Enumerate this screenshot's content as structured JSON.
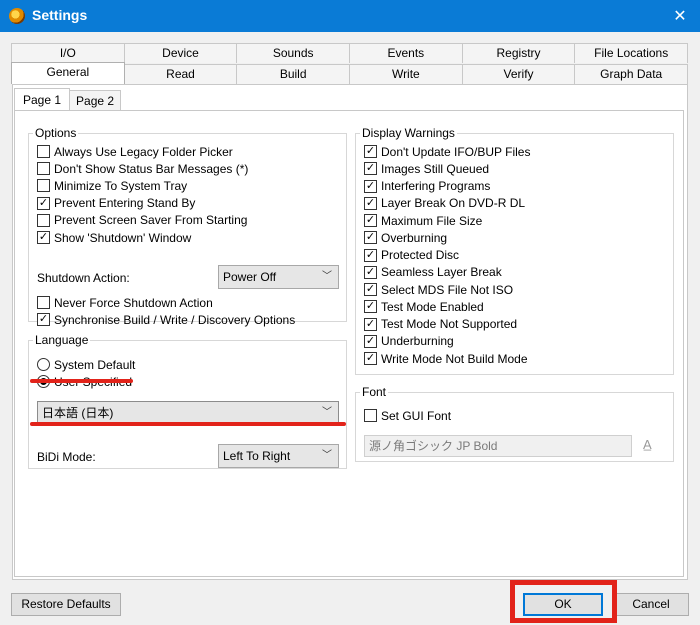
{
  "window": {
    "title": "Settings",
    "close_glyph": "✕"
  },
  "tabs_row1": [
    "I/O",
    "Device",
    "Sounds",
    "Events",
    "Registry",
    "File Locations"
  ],
  "tabs_row2": [
    "General",
    "Read",
    "Build",
    "Write",
    "Verify",
    "Graph Data"
  ],
  "active_tab": "General",
  "subtabs": [
    "Page 1",
    "Page 2"
  ],
  "options": {
    "legend": "Options",
    "items": [
      {
        "label": "Always Use Legacy Folder Picker",
        "checked": false
      },
      {
        "label": "Don't Show Status Bar Messages (*)",
        "checked": false
      },
      {
        "label": "Minimize To System Tray",
        "checked": false
      },
      {
        "label": "Prevent Entering Stand By",
        "checked": true
      },
      {
        "label": "Prevent Screen Saver From Starting",
        "checked": false
      },
      {
        "label": "Show 'Shutdown' Window",
        "checked": true
      }
    ],
    "shutdown_label": "Shutdown Action:",
    "shutdown_value": "Power Off",
    "items2": [
      {
        "label": "Never Force Shutdown Action",
        "checked": false
      },
      {
        "label": "Synchronise Build / Write / Discovery Options",
        "checked": true
      }
    ]
  },
  "language": {
    "legend": "Language",
    "radio_system": "System Default",
    "radio_user": "User Specified",
    "selected": "User Specified",
    "value": "日本語 (日本)",
    "bidi_label": "BiDi Mode:",
    "bidi_value": "Left To Right"
  },
  "warnings": {
    "legend": "Display Warnings",
    "items": [
      {
        "label": "Don't Update IFO/BUP Files",
        "checked": true
      },
      {
        "label": "Images Still Queued",
        "checked": true
      },
      {
        "label": "Interfering Programs",
        "checked": true
      },
      {
        "label": "Layer Break On DVD-R DL",
        "checked": true
      },
      {
        "label": "Maximum File Size",
        "checked": true
      },
      {
        "label": "Overburning",
        "checked": true
      },
      {
        "label": "Protected Disc",
        "checked": true
      },
      {
        "label": "Seamless Layer Break",
        "checked": true
      },
      {
        "label": "Select MDS File Not ISO",
        "checked": true
      },
      {
        "label": "Test Mode Enabled",
        "checked": true
      },
      {
        "label": "Test Mode Not Supported",
        "checked": true
      },
      {
        "label": "Underburning",
        "checked": true
      },
      {
        "label": "Write Mode Not Build Mode",
        "checked": true
      }
    ]
  },
  "font": {
    "legend": "Font",
    "set_gui_font_label": "Set GUI Font",
    "set_gui_font_checked": false,
    "font_value": "源ノ角ゴシック JP Bold"
  },
  "buttons": {
    "restore": "Restore Defaults",
    "ok": "OK",
    "cancel": "Cancel"
  },
  "colors": {
    "titlebar": "#0a7bd6",
    "highlight": "#e2231a"
  }
}
